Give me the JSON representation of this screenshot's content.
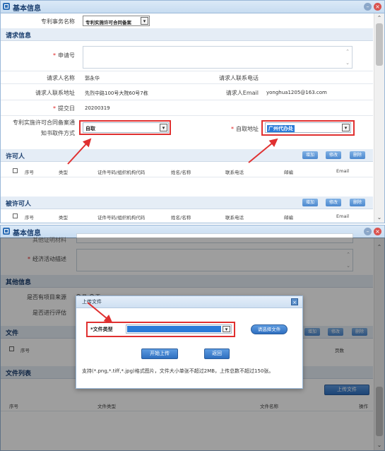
{
  "panel1": {
    "title": "基本信息",
    "top_row": {
      "label": "专利事务名称",
      "value": "专利实施许可合同备案"
    },
    "section_request": "请求信息",
    "fields": {
      "application_no_label": "申请号",
      "requester_name_label": "请求人名称",
      "requester_name_value": "郭永华",
      "requester_phone_label": "请求人联系电话",
      "requester_address_label": "请求人联系地址",
      "requester_address_value": "先烈中路100号大院60号7栋",
      "requester_email_label": "请求人Email",
      "requester_email_value": "yonghua1205@163.com",
      "submit_date_label": "提交日",
      "submit_date_value": "20200319",
      "notice_method_label_line1": "专利实施许可合同备案通",
      "notice_method_label_line2": "知书取件方式",
      "notice_method_value": "自取",
      "pickup_address_label": "自取地址",
      "pickup_address_value": "广州代办处"
    },
    "section_licensor": "许可人",
    "section_licensee": "被许可人",
    "buttons": {
      "add": "增加",
      "edit": "修改",
      "delete": "删除"
    },
    "table_headers": [
      "序号",
      "类型",
      "证件号码/组织机构代码",
      "姓名/名称",
      "联系电话",
      "邮编",
      "Email"
    ]
  },
  "panel2": {
    "title": "基本信息",
    "partial_label": "其他证明材料",
    "econ_label": "经济活动描述",
    "section_other": "其他信息",
    "project_source_label": "是否有项目来源",
    "radio_yes": "是",
    "radio_no": "否",
    "evaluation_label": "是否进行评估",
    "section_files": "文件",
    "files_headers": {
      "no": "序号",
      "pages": "页数"
    },
    "buttons": {
      "add": "增加",
      "edit": "修改",
      "delete": "删除"
    },
    "section_file_list": "文件列表",
    "upload_file_button": "上传文件",
    "file_list_headers": {
      "no": "序号",
      "type": "文件类型",
      "name": "文件名称",
      "op": "操作"
    }
  },
  "dialog": {
    "title": "上传文件",
    "file_type_label": "*文件类型",
    "choose_file_button": "请选择文件",
    "start_upload_button": "开始上传",
    "back_button": "返回",
    "note": "支持(*.png,*.tiff,*.jpg)格式图片，文件大小单张不超过2MB，上传总数不超过150张。"
  },
  "colors": {
    "accent": "#2f6fb6",
    "highlight": "#e03030",
    "select_highlight": "#2a7bd8"
  }
}
